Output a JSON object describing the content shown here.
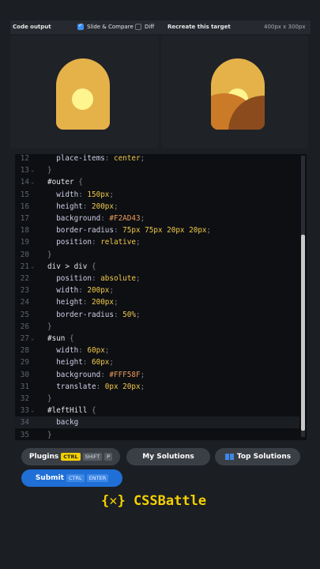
{
  "header": {
    "code_output": "Code output",
    "slide_compare": "Slide & Compare",
    "diff": "Diff",
    "recreate": "Recreate this target",
    "size": "400px x 300px"
  },
  "colors": {
    "accent": "#f5d000",
    "submit": "#1f6fd6",
    "outer": "#F2AD43",
    "sun": "#FFF58F"
  },
  "editor": {
    "lines": [
      {
        "n": "12",
        "fold": "",
        "html": "  <span class='prop'>place-items</span><span class='pun'>: </span><span class='val'>center</span><span class='pun'>;</span>"
      },
      {
        "n": "13",
        "fold": "⌄",
        "html": "<span class='pun'>}</span>"
      },
      {
        "n": "14",
        "fold": "⌄",
        "html": "<span class='sel'>#outer</span> <span class='pun'>{</span>"
      },
      {
        "n": "15",
        "fold": "",
        "html": "  <span class='prop'>width</span><span class='pun'>: </span><span class='val'>150px</span><span class='pun'>;</span>"
      },
      {
        "n": "16",
        "fold": "",
        "html": "  <span class='prop'>height</span><span class='pun'>: </span><span class='val'>200px</span><span class='pun'>;</span>"
      },
      {
        "n": "17",
        "fold": "",
        "html": "  <span class='prop'>background</span><span class='pun'>: </span><span class='str'>#F2AD43</span><span class='pun'>;</span>"
      },
      {
        "n": "18",
        "fold": "",
        "html": "  <span class='prop'>border-radius</span><span class='pun'>: </span><span class='val'>75px 75px 20px 20px</span><span class='pun'>;</span>"
      },
      {
        "n": "19",
        "fold": "",
        "html": "  <span class='prop'>position</span><span class='pun'>: </span><span class='val'>relative</span><span class='pun'>;</span>"
      },
      {
        "n": "20",
        "fold": "",
        "html": "<span class='pun'>}</span>"
      },
      {
        "n": "21",
        "fold": "⌄",
        "html": "<span class='sel'>div &gt; div</span> <span class='pun'>{</span>"
      },
      {
        "n": "22",
        "fold": "",
        "html": "  <span class='prop'>position</span><span class='pun'>: </span><span class='val'>absolute</span><span class='pun'>;</span>"
      },
      {
        "n": "23",
        "fold": "",
        "html": "  <span class='prop'>width</span><span class='pun'>: </span><span class='val'>200px</span><span class='pun'>;</span>"
      },
      {
        "n": "24",
        "fold": "",
        "html": "  <span class='prop'>height</span><span class='pun'>: </span><span class='val'>200px</span><span class='pun'>;</span>"
      },
      {
        "n": "25",
        "fold": "",
        "html": "  <span class='prop'>border-radius</span><span class='pun'>: </span><span class='val'>50%</span><span class='pun'>;</span>"
      },
      {
        "n": "26",
        "fold": "",
        "html": "<span class='pun'>}</span>"
      },
      {
        "n": "27",
        "fold": "⌄",
        "html": "<span class='sel'>#sun</span> <span class='pun'>{</span>"
      },
      {
        "n": "28",
        "fold": "",
        "html": "  <span class='prop'>width</span><span class='pun'>: </span><span class='val'>60px</span><span class='pun'>;</span>"
      },
      {
        "n": "29",
        "fold": "",
        "html": "  <span class='prop'>height</span><span class='pun'>: </span><span class='val'>60px</span><span class='pun'>;</span>"
      },
      {
        "n": "30",
        "fold": "",
        "html": "  <span class='prop'>background</span><span class='pun'>: </span><span class='str'>#FFF58F</span><span class='pun'>;</span>"
      },
      {
        "n": "31",
        "fold": "",
        "html": "  <span class='prop'>translate</span><span class='pun'>: </span><span class='val'>0px 20px</span><span class='pun'>;</span>"
      },
      {
        "n": "32",
        "fold": "",
        "html": "<span class='pun'>}</span>"
      },
      {
        "n": "33",
        "fold": "⌄",
        "html": "<span class='sel'>#leftHill</span> <span class='pun'>{</span>"
      },
      {
        "n": "34",
        "fold": "",
        "html": "  <span class='prop'>backg</span>"
      },
      {
        "n": "35",
        "fold": "",
        "html": "<span class='pun'>}</span>"
      }
    ]
  },
  "buttons": {
    "plugins": "Plugins",
    "ctrl": "CTRL",
    "shift": "SHIFT",
    "p": "P",
    "my_solutions": "My Solutions",
    "top_solutions": "Top Solutions",
    "submit": "Submit",
    "enter": "ENTER"
  },
  "logo": {
    "text": "{✕} CSSBattle",
    "name": "CSSBattle"
  }
}
